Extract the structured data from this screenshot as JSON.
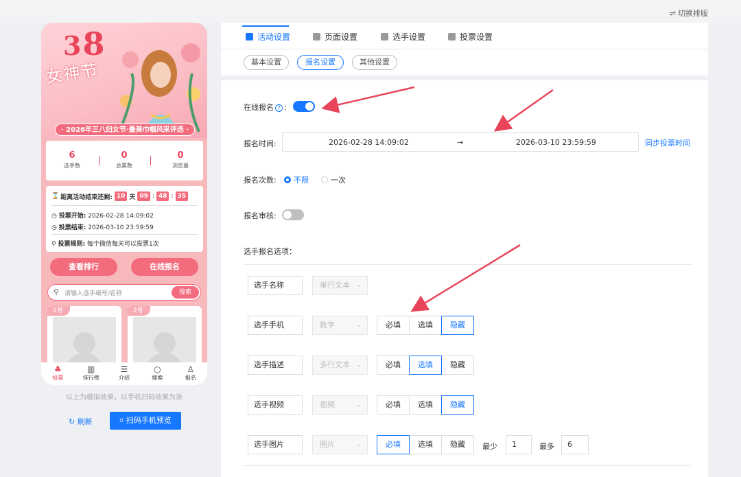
{
  "top": {
    "switch_label": "切换排版"
  },
  "phone": {
    "banner_38": "3",
    "banner_8": "8",
    "banner_name": "女神节",
    "ribbon": "· 2026年三八妇女节·最美巾帼风采评选 ·",
    "stats": [
      {
        "value": "6",
        "label": "选手数"
      },
      {
        "value": "0",
        "label": "总票数"
      },
      {
        "value": "0",
        "label": "浏览量"
      }
    ],
    "countdown": {
      "prefix": "距离活动结束还剩:",
      "days": "10",
      "day_unit": "天",
      "h": "09",
      "m": "48",
      "s": "35"
    },
    "vote_start_label": "投票开始:",
    "vote_start": "2026-02-28 14:09:02",
    "vote_end_label": "投票结束:",
    "vote_end": "2026-03-10 23:59:59",
    "rule_label": "投票规则:",
    "rule": "每个微信每天可以投票1次",
    "btn_rank": "查看排行",
    "btn_signup": "在线报名",
    "search_placeholder": "请输入选手编号/名称",
    "search_btn": "搜索",
    "cards": [
      "1号",
      "2号"
    ],
    "tabs": [
      "投票",
      "排行榜",
      "介绍",
      "搜索",
      "报名"
    ]
  },
  "hint": "以上为模拟效果，以手机扫码效果为准",
  "refresh": "刷新",
  "scan": "扫码手机预览",
  "tabs": [
    "活动设置",
    "页面设置",
    "选手设置",
    "投票设置"
  ],
  "subtabs": [
    "基本设置",
    "报名设置",
    "其他设置"
  ],
  "form": {
    "online_signup": "在线报名",
    "online_signup_on": true,
    "signup_time": "报名时间:",
    "start": "2026-02-28 14:09:02",
    "arrow": "→",
    "end": "2026-03-10 23:59:59",
    "sync": "同步投票时间",
    "count_label": "报名次数:",
    "count_opt1": "不限",
    "count_opt2": "一次",
    "review": "报名审核:",
    "review_on": false,
    "options_label": "选手报名选项："
  },
  "fields": [
    {
      "name": "选手名称",
      "type": "单行文本"
    },
    {
      "name": "选手手机",
      "type": "数字",
      "seg": [
        "必填",
        "选填",
        "隐藏"
      ],
      "selected": "隐藏"
    },
    {
      "name": "选手描述",
      "type": "多行文本",
      "seg": [
        "必填",
        "选填",
        "隐藏"
      ],
      "selected": "选填"
    },
    {
      "name": "选手视频",
      "type": "视频",
      "seg": [
        "必填",
        "选填",
        "隐藏"
      ],
      "selected": "隐藏"
    },
    {
      "name": "选手图片",
      "type": "图片",
      "seg": [
        "必填",
        "选填",
        "隐藏"
      ],
      "selected": "必填",
      "min_label": "最少",
      "min": "1",
      "max_label": "最多",
      "max": "6"
    }
  ],
  "colors": {
    "accent": "#1677ff",
    "pink": "#f26c7d",
    "arrow": "#e8455a"
  }
}
